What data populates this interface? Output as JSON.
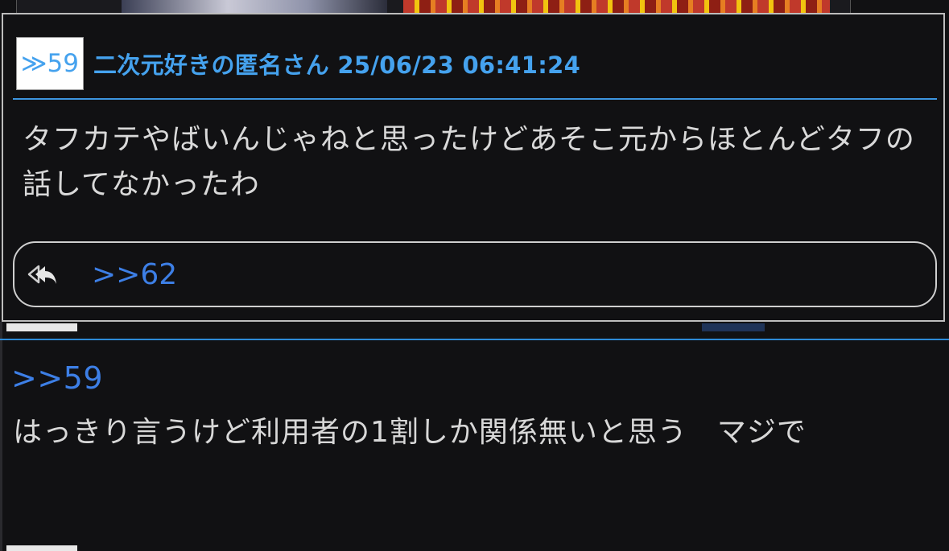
{
  "popup": {
    "res_number": "≫59",
    "poster_meta": "二次元好きの匿名さん 25/06/23 06:41:24",
    "body": "タフカテやばいんじゃねと思ったけどあそこ元からほとんどタフの話してなかったわ",
    "reply_icon": "reply-all-icon",
    "reply_link": ">>62"
  },
  "thread": {
    "next_post": {
      "reply_anchor": ">>59",
      "body": "はっきり言うけど利用者の1割しか関係無いと思う　マジで"
    }
  },
  "colors": {
    "background": "#111113",
    "accent_blue": "#45a2ee",
    "link_blue": "#3d7fe6",
    "divider_blue": "#2d8ad6",
    "text": "#d9d9d9"
  }
}
